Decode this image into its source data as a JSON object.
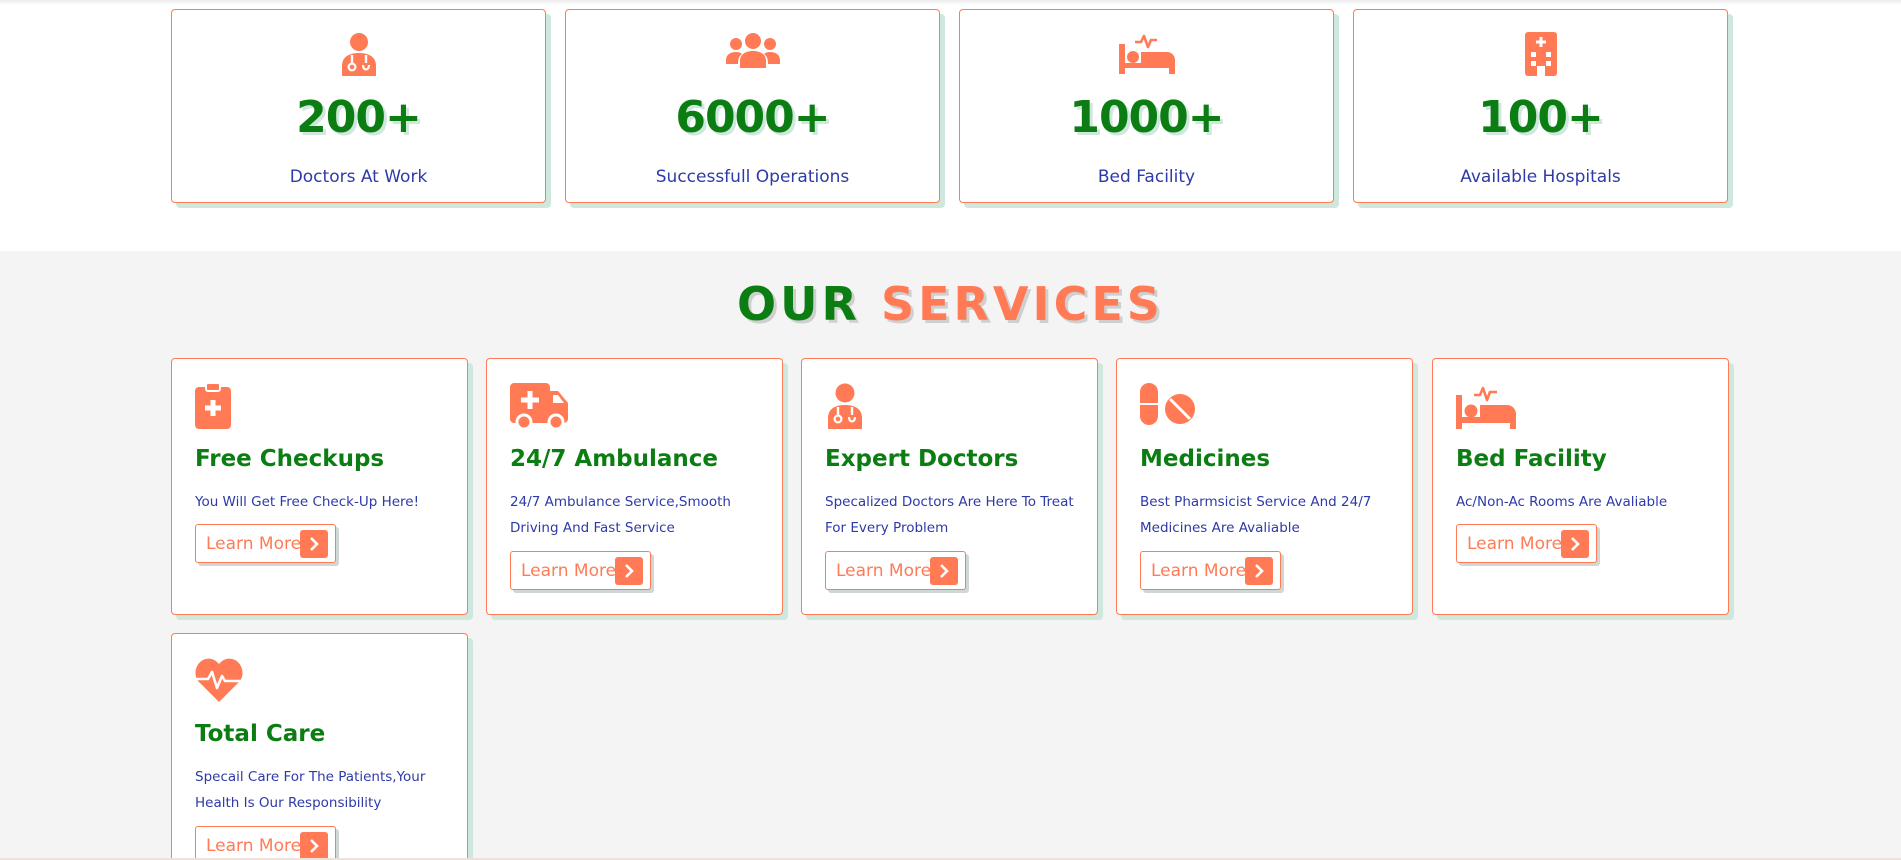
{
  "colors": {
    "accent": "#ff7a55",
    "green": "#0c7d12",
    "text_blue": "#2e3aa8",
    "section_bg": "#f4f4f4"
  },
  "stats": [
    {
      "icon": "doctor-icon",
      "value": "200+",
      "label": "Doctors At Work"
    },
    {
      "icon": "users-group-icon",
      "value": "6000+",
      "label": "Successfull Operations"
    },
    {
      "icon": "hospital-bed-icon",
      "value": "1000+",
      "label": "Bed Facility"
    },
    {
      "icon": "hospital-building-icon",
      "value": "100+",
      "label": "Available Hospitals"
    }
  ],
  "services_heading": {
    "word1": "OUR",
    "word2": "SERVICES"
  },
  "services": [
    {
      "icon": "clipboard-plus-icon",
      "title": "Free Checkups",
      "desc": "You Will Get Free Check-Up Here!",
      "button": "Learn More"
    },
    {
      "icon": "ambulance-icon",
      "title": "24/7 Ambulance",
      "desc": "24/7 Ambulance Service,Smooth Driving And Fast Service",
      "button": "Learn More"
    },
    {
      "icon": "doctor-icon",
      "title": "Expert Doctors",
      "desc": "Specalized Doctors Are Here To Treat For Every Problem",
      "button": "Learn More"
    },
    {
      "icon": "pills-icon",
      "title": "Medicines",
      "desc": "Best Pharmsicist Service And 24/7 Medicines Are Avaliable",
      "button": "Learn More"
    },
    {
      "icon": "hospital-bed-icon",
      "title": "Bed Facility",
      "desc": "Ac/Non-Ac Rooms Are Avaliable",
      "button": "Learn More"
    },
    {
      "icon": "heart-pulse-icon",
      "title": "Total Care",
      "desc": "Specail Care For The Patients,Your Health Is Our Responsibility",
      "button": "Learn More"
    }
  ]
}
